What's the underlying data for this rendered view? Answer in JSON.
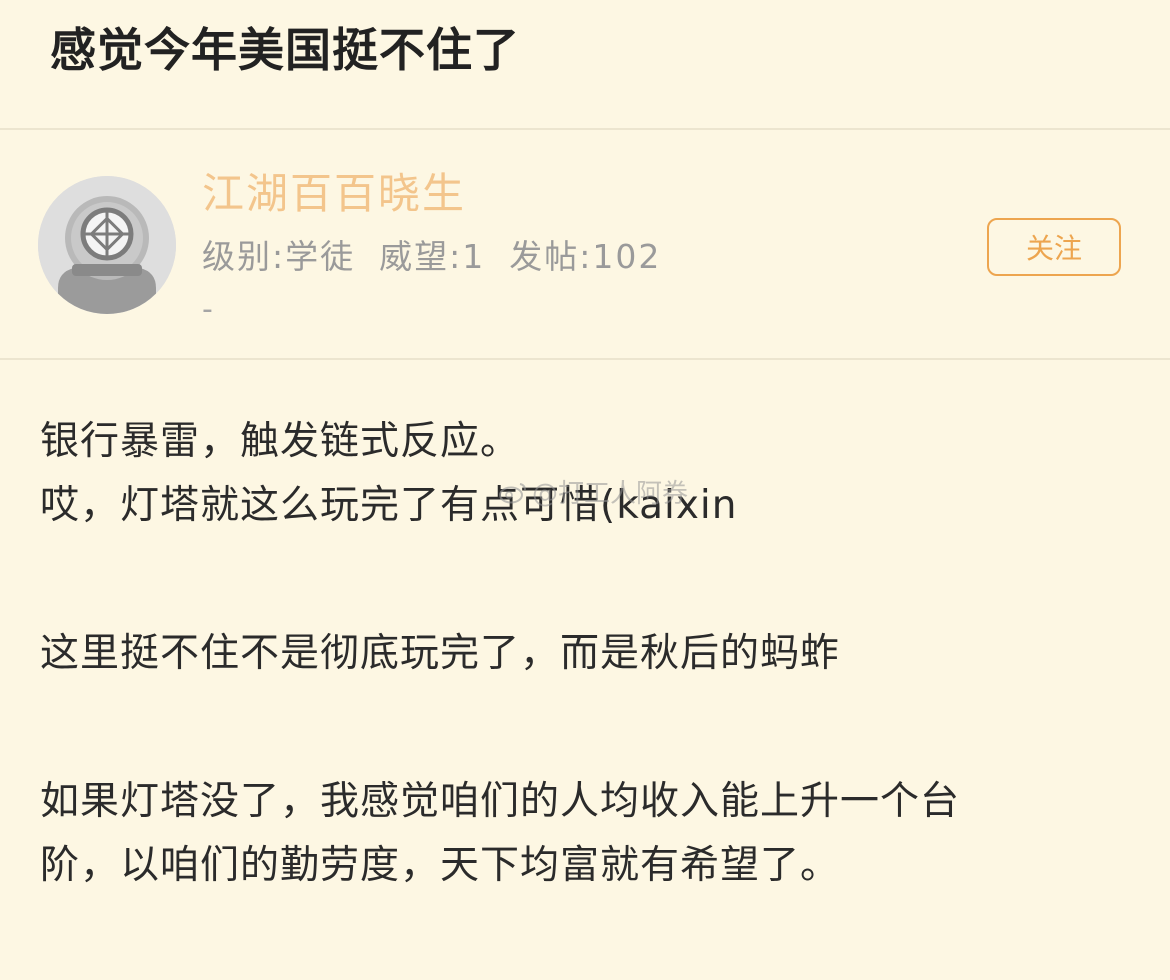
{
  "post": {
    "title": "感觉今年美国挺不住了"
  },
  "author": {
    "name": "江湖百百晓生",
    "level": "级别:学徒",
    "prestige": "威望:1",
    "posts": "发帖:102",
    "signature": "-",
    "follow_label": "关注",
    "avatar_icon": "diving-helmet-icon"
  },
  "content": {
    "lines": [
      "银行暴雷，触发链式反应。",
      "哎，灯塔就这么玩完了有点可惜(kaixin",
      "这里挺不住不是彻底玩完了，而是秋后的蚂蚱",
      "如果灯塔没了，我感觉咱们的人均收入能上升一个台",
      "阶，以咱们的勤劳度，天下均富就有希望了。"
    ]
  },
  "watermark": {
    "text": "@打工人阿券",
    "icon": "weibo-logo-icon"
  },
  "colors": {
    "background": "#fdf7e3",
    "username": "#f3c58c",
    "accent": "#eda54f",
    "meta": "#9a9a9a"
  }
}
